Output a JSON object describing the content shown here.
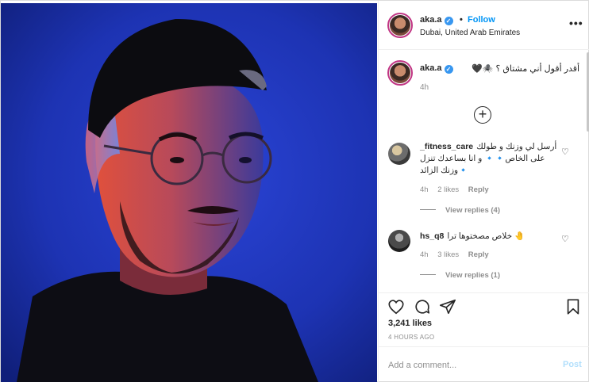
{
  "header": {
    "username": "aka.a",
    "separator": "•",
    "follow_label": "Follow",
    "location": "Dubai, United Arab Emirates",
    "more_label": "•••"
  },
  "caption": {
    "username": "aka.a",
    "text": "أقدر أقول أني مشتاق ؟ 🕷️🖤",
    "time": "4h"
  },
  "load_more_label": "+",
  "comments": [
    {
      "username": "_fitness_care",
      "text": "أرسل لي وزنك و طولك على الخاص🔹🔹 و انا بساعدك تنزل وزنك الزائد🔹",
      "time": "4h",
      "likes": "2 likes",
      "reply_label": "Reply",
      "view_replies": "View replies (4)"
    },
    {
      "username": "hs_q8",
      "text": "خلاص مصختوها ترا 🤚",
      "time": "4h",
      "likes": "3 likes",
      "reply_label": "Reply",
      "view_replies": "View replies (1)"
    }
  ],
  "actions": {
    "icons": [
      "heart-icon",
      "comment-icon",
      "share-icon",
      "bookmark-icon"
    ],
    "likes": "3,241 likes",
    "time_ago": "4 HOURS AGO"
  },
  "add_comment": {
    "placeholder": "Add a comment...",
    "post_label": "Post"
  },
  "colors": {
    "accent": "#0095f6",
    "post_disabled": "#b2dffc",
    "photo_background": "#1b2fa8"
  }
}
